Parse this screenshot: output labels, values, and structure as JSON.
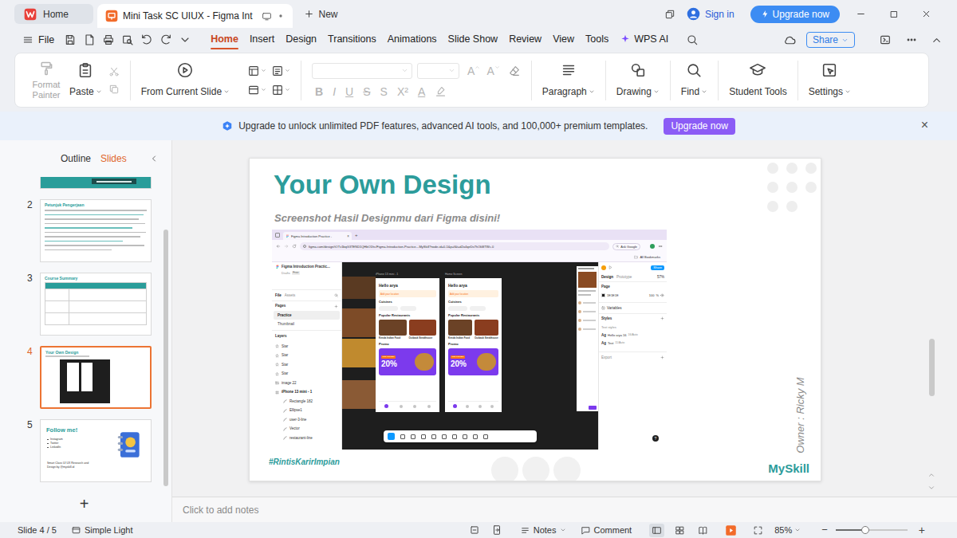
{
  "window": {
    "tabs": [
      {
        "label": "Home",
        "selected": false
      },
      {
        "label": "Mini Task SC UIUX - Figma Int",
        "selected": true
      }
    ],
    "new_tab": "New",
    "sign_in": "Sign in",
    "upgrade": "Upgrade now"
  },
  "menu": {
    "file": "File",
    "tabs": [
      {
        "label": "Home",
        "selected": true
      },
      {
        "label": "Insert",
        "selected": false
      },
      {
        "label": "Design",
        "selected": false
      },
      {
        "label": "Transitions",
        "selected": false
      },
      {
        "label": "Animations",
        "selected": false
      },
      {
        "label": "Slide Show",
        "selected": false
      },
      {
        "label": "Review",
        "selected": false
      },
      {
        "label": "View",
        "selected": false
      },
      {
        "label": "Tools",
        "selected": false
      },
      {
        "label": "WPS AI",
        "selected": false
      }
    ],
    "share": "Share"
  },
  "ribbon": {
    "format_painter": {
      "label": "Format Painter",
      "disabled": true
    },
    "paste": "Paste",
    "from_current_slide": "From Current Slide",
    "size_buttons": [
      {
        "label": "A",
        "disabled": true
      },
      {
        "label": "A",
        "disabled": true
      }
    ],
    "font_buttons": [
      {
        "label": "B",
        "disabled": true
      },
      {
        "label": "I",
        "disabled": true
      },
      {
        "label": "U",
        "disabled": true
      },
      {
        "label": "S",
        "disabled": true
      },
      {
        "label": "S",
        "disabled": true
      },
      {
        "label": "X²",
        "disabled": true
      },
      {
        "label": "A",
        "disabled": true
      }
    ],
    "paragraph": "Paragraph",
    "drawing": "Drawing",
    "find": "Find",
    "student_tools": "Student Tools",
    "settings": "Settings"
  },
  "banner": {
    "text": "Upgrade to unlock unlimited PDF features, advanced AI tools, and 100,000+ premium templates.",
    "button": "Upgrade now",
    "close": "×"
  },
  "panel": {
    "tabs": [
      {
        "label": "Outline",
        "selected": false
      },
      {
        "label": "Slides",
        "selected": true
      }
    ],
    "add": "+",
    "slides": [
      {
        "kind": "cover",
        "selected": false
      },
      {
        "kind": "text",
        "number": "2",
        "selected": false,
        "title": "Petunjuk Pengerjaan"
      },
      {
        "kind": "table",
        "number": "3",
        "selected": false,
        "title": "Course Summary"
      },
      {
        "kind": "screenshot",
        "number": "4",
        "selected": true,
        "title": "Your Own Design"
      },
      {
        "kind": "follow",
        "number": "5",
        "selected": false,
        "title": "Follow me!",
        "lines": [
          "Instagram",
          "Twitter",
          "LinkedIn"
        ],
        "footer": "Smart Class UI UX Research and Design by @myskill.id"
      }
    ]
  },
  "slide": {
    "title": "Your Own Design",
    "subtitle": "Screenshot Hasil Designmu dari Figma disini!",
    "owner": "Owner : Ricky M",
    "hashtag": "#RintisKarirImpian",
    "brand": "MySkill",
    "screenshot": {
      "browser": {
        "tab": "Figma Introduction Practice - ",
        "tab_close": "×",
        "new_tab": "+",
        "url": "figma.com/design/tOTv1bqG3TEND1QHbO1frc/Figma-Introduction-Practice---MySkill?node-id=0-1&p=f&t=d2o4qeDs7hOkMTWc-0",
        "ask_google": "Ask Google",
        "bookmarks": "All Bookmarks"
      },
      "figma": {
        "file": "Figma Introduction Practic...",
        "drafts": "Drafts",
        "plan": "Free",
        "tabs": [
          {
            "label": "File",
            "selected": true
          },
          {
            "label": "Assets",
            "selected": false
          }
        ],
        "pages_title": "Pages",
        "pages": [
          {
            "label": "Practice",
            "selected": true
          },
          {
            "label": "Thumbnail",
            "selected": false
          }
        ],
        "layers_title": "Layers",
        "layers": [
          {
            "label": "Star",
            "kind": "star"
          },
          {
            "label": "Star",
            "kind": "star"
          },
          {
            "label": "Star",
            "kind": "star"
          },
          {
            "label": "Star",
            "kind": "star"
          },
          {
            "label": "image 22",
            "kind": "image"
          },
          {
            "label": "iPhone 13 mini - 1",
            "kind": "frame"
          },
          {
            "label": "Rectangle 182",
            "kind": "child"
          },
          {
            "label": "Ellipse1",
            "kind": "child"
          },
          {
            "label": "user-3-line",
            "kind": "child"
          },
          {
            "label": "Vector",
            "kind": "child"
          },
          {
            "label": "restaurant-line",
            "kind": "child"
          }
        ]
      },
      "frames": [
        {
          "label": "iPhone 13 mini - 1",
          "greeting": "Hello arya",
          "location": "Add your location",
          "cuisines": "Cuisines",
          "popular": "Popular Restaurants",
          "restaurants": [
            "Kenda Indian Food",
            "Outback Steakhouse"
          ],
          "promo": "Promo",
          "promo_badge": "GET PROMO",
          "promo_value": "20%"
        },
        {
          "label": "Home Screen",
          "greeting": "Hello arya",
          "location": "Add your location",
          "cuisines": "Cuisines",
          "popular": "Popular Restaurants",
          "restaurants": [
            "Kenda Indian Food",
            "Outback Steakhouse"
          ],
          "promo": "Promo",
          "promo_badge": "GET PROMO",
          "promo_value": "20%"
        }
      ],
      "design_panel": {
        "share": "Share",
        "tabs": [
          {
            "label": "Design",
            "selected": true
          },
          {
            "label": "Prototype",
            "selected": false
          }
        ],
        "zoom": "57%",
        "page": "Page",
        "color": "1E1E1E",
        "opacity": "100",
        "percent": "%",
        "variables": "Variables",
        "styles": "Styles",
        "text_styles": "Text styles",
        "styles_list": [
          {
            "sample": "Ag",
            "name": "Hello arya 16",
            "meta": "16/Auto"
          },
          {
            "sample": "Ag",
            "name": "Text",
            "meta": "11/Auto"
          }
        ],
        "export": "Export",
        "help": "?"
      }
    }
  },
  "notes": {
    "placeholder": "Click to add notes"
  },
  "status_bar": {
    "slide": "Slide 4 / 5",
    "theme": "Simple Light",
    "notes": "Notes",
    "comment": "Comment",
    "views": [
      {
        "selected": true
      },
      {
        "selected": false
      },
      {
        "selected": false
      }
    ],
    "zoom": "85%",
    "minus": "−",
    "plus": "+",
    "zoom_level": 0.41
  }
}
